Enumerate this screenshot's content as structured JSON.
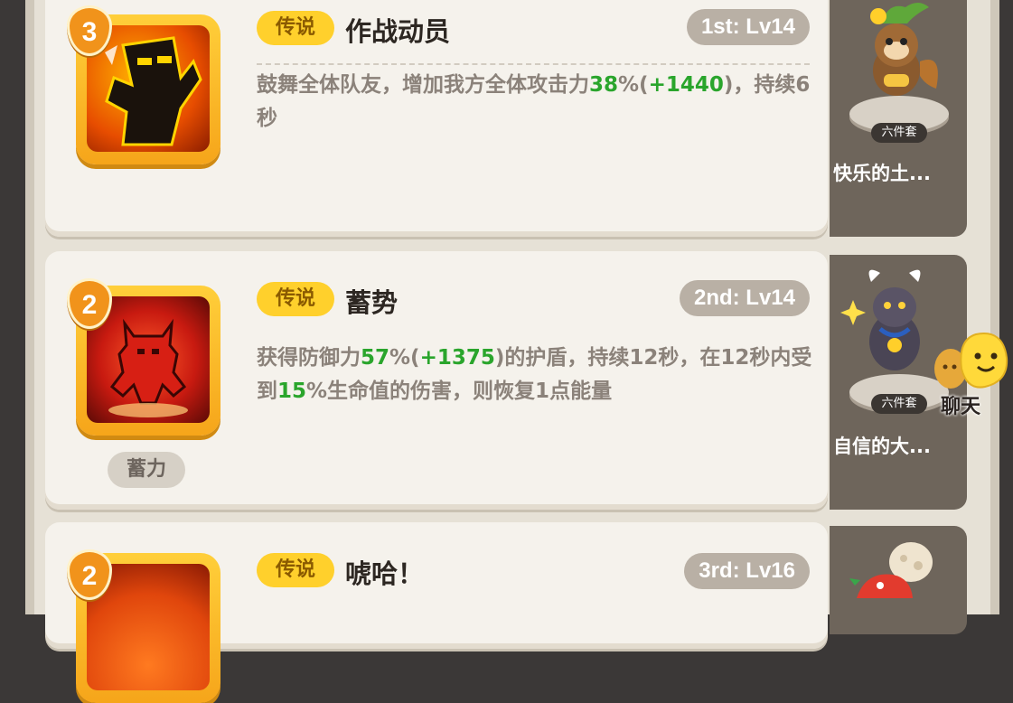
{
  "skills": [
    {
      "level_badge": "3",
      "rarity": "传说",
      "name": "作战动员",
      "rank": "1st: Lv14",
      "desc_pre": "鼓舞全体队友，增加我方全体攻击力",
      "desc_pct": "38",
      "desc_mid": "%(",
      "desc_bonus": "+1440",
      "desc_post": ")，持续6秒"
    },
    {
      "level_badge": "2",
      "rarity": "传说",
      "name": "蓄势",
      "rank": "2nd: Lv14",
      "desc_pre": "获得防御力",
      "desc_pct": "57",
      "desc_mid": "%(",
      "desc_bonus": "+1375",
      "desc_post": ")的护盾，持续12秒，在12秒内受到",
      "desc_pct2": "15",
      "desc_post2": "%生命值的伤害，则恢复1点能量",
      "sub_tag": "蓄力"
    },
    {
      "level_badge": "2",
      "rarity": "传说",
      "name": "唬哈！",
      "rank": "3rd: Lv16"
    }
  ],
  "pets": [
    {
      "set_label": "六件套",
      "name": "快乐的土..."
    },
    {
      "set_label": "六件套",
      "name": "自信的大..."
    }
  ],
  "chat": {
    "label": "聊天"
  },
  "colors": {
    "highlight_green": "#2aa52c",
    "rarity_yellow": "#ffd02c",
    "badge_orange": "#f1931b"
  }
}
